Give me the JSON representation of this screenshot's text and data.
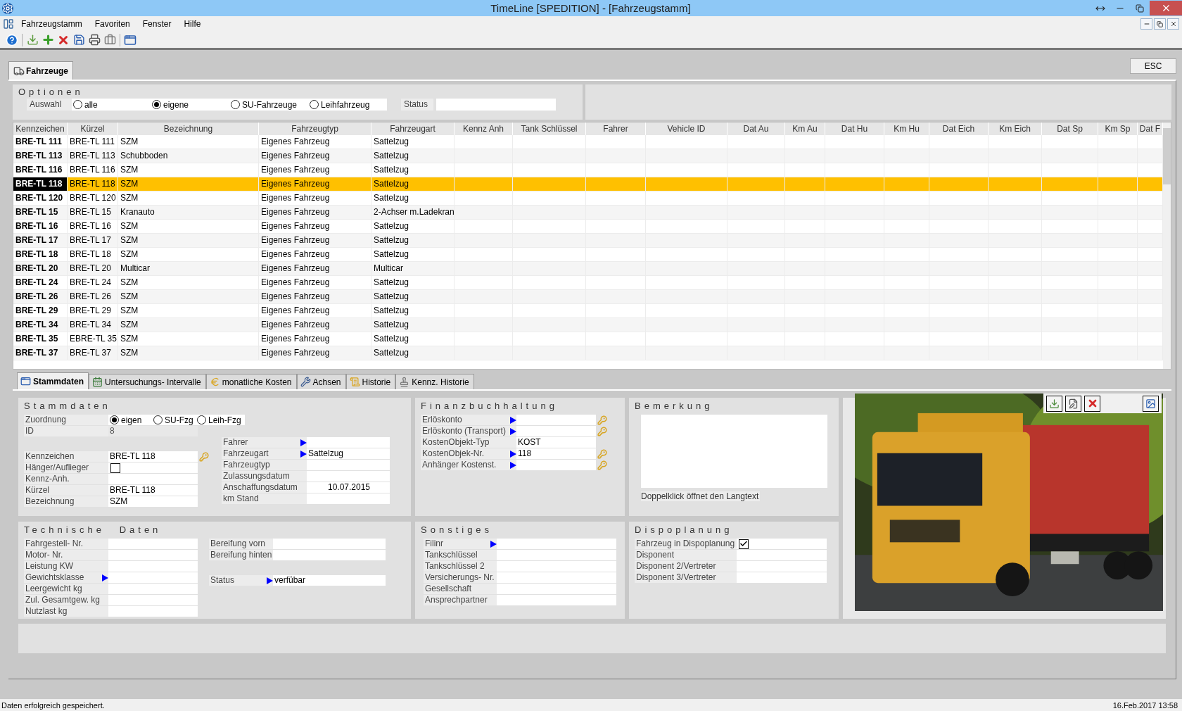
{
  "window": {
    "title": "TimeLine [SPEDITION] - [Fahrzeugstamm]"
  },
  "menu": [
    "Fahrzeugstamm",
    "Favoriten",
    "Fenster",
    "Hilfe"
  ],
  "main_tab": {
    "label": "Fahrzeuge",
    "selected": true
  },
  "esc_button": "ESC",
  "options": {
    "title": "Optionen",
    "selection_label": "Auswahl",
    "radios": [
      {
        "label": "alle",
        "selected": false
      },
      {
        "label": "eigene",
        "selected": true
      },
      {
        "label": "SU-Fahrzeuge",
        "selected": false
      },
      {
        "label": "Leihfahrzeug",
        "selected": false
      }
    ],
    "status_label": "Status"
  },
  "table": {
    "columns": [
      "Kennzeichen",
      "Kürzel",
      "Bezeichnung",
      "Fahrzeugtyp",
      "Fahrzeugart",
      "Kennz Anh",
      "Tank Schlüssel",
      "Fahrer",
      "Vehicle ID",
      "Dat Au",
      "Km Au",
      "Dat Hu",
      "Km Hu",
      "Dat Eich",
      "Km Eich",
      "Dat Sp",
      "Km Sp",
      "Dat F"
    ],
    "rows": [
      {
        "cells": [
          "BRE-TL 111",
          "BRE-TL 111",
          "SZM",
          "Eigenes Fahrzeug",
          "Sattelzug"
        ],
        "selected": false
      },
      {
        "cells": [
          "BRE-TL 113",
          "BRE-TL 113",
          "Schubboden",
          "Eigenes Fahrzeug",
          "Sattelzug"
        ],
        "selected": false
      },
      {
        "cells": [
          "BRE-TL 116",
          "BRE-TL 116",
          "SZM",
          "Eigenes Fahrzeug",
          "Sattelzug"
        ],
        "selected": false
      },
      {
        "cells": [
          "BRE-TL 118",
          "BRE-TL 118",
          "SZM",
          "Eigenes Fahrzeug",
          "Sattelzug"
        ],
        "selected": true
      },
      {
        "cells": [
          "BRE-TL 120",
          "BRE-TL 120",
          "SZM",
          "Eigenes Fahrzeug",
          "Sattelzug"
        ],
        "selected": false
      },
      {
        "cells": [
          "BRE-TL 15",
          "BRE-TL 15",
          "Kranauto",
          "Eigenes Fahrzeug",
          "2-Achser m.Ladekran"
        ],
        "selected": false
      },
      {
        "cells": [
          "BRE-TL 16",
          "BRE-TL 16",
          "SZM",
          "Eigenes Fahrzeug",
          "Sattelzug"
        ],
        "selected": false
      },
      {
        "cells": [
          "BRE-TL 17",
          "BRE-TL 17",
          "SZM",
          "Eigenes Fahrzeug",
          "Sattelzug"
        ],
        "selected": false
      },
      {
        "cells": [
          "BRE-TL 18",
          "BRE-TL 18",
          "SZM",
          "Eigenes Fahrzeug",
          "Sattelzug"
        ],
        "selected": false
      },
      {
        "cells": [
          "BRE-TL 20",
          "BRE-TL 20",
          "Multicar",
          "Eigenes Fahrzeug",
          "Multicar"
        ],
        "selected": false
      },
      {
        "cells": [
          "BRE-TL 24",
          "BRE-TL 24",
          "SZM",
          "Eigenes Fahrzeug",
          "Sattelzug"
        ],
        "selected": false
      },
      {
        "cells": [
          "BRE-TL 26",
          "BRE-TL 26",
          "SZM",
          "Eigenes Fahrzeug",
          "Sattelzug"
        ],
        "selected": false
      },
      {
        "cells": [
          "BRE-TL 29",
          "BRE-TL 29",
          "SZM",
          "Eigenes Fahrzeug",
          "Sattelzug"
        ],
        "selected": false
      },
      {
        "cells": [
          "BRE-TL 34",
          "BRE-TL 34",
          "SZM",
          "Eigenes Fahrzeug",
          "Sattelzug"
        ],
        "selected": false
      },
      {
        "cells": [
          "BRE-TL 35",
          "EBRE-TL 35",
          "SZM",
          "Eigenes Fahrzeug",
          "Sattelzug"
        ],
        "selected": false
      },
      {
        "cells": [
          "BRE-TL 37",
          "BRE-TL 37",
          "SZM",
          "Eigenes Fahrzeug",
          "Sattelzug"
        ],
        "selected": false
      }
    ]
  },
  "detail_tabs": [
    {
      "label": "Stammdaten",
      "selected": true
    },
    {
      "label": "Untersuchungs- Intervalle",
      "selected": false
    },
    {
      "label": "monatliche Kosten",
      "selected": false
    },
    {
      "label": "Achsen",
      "selected": false
    },
    {
      "label": "Historie",
      "selected": false
    },
    {
      "label": "Kennz. Historie",
      "selected": false
    }
  ],
  "stammdaten": {
    "title": "Stammdaten",
    "assignment": {
      "label": "Zuordnung",
      "radios": [
        {
          "label": "eigen",
          "selected": true
        },
        {
          "label": "SU-Fzg",
          "selected": false
        },
        {
          "label": "Leih-Fzg",
          "selected": false
        }
      ]
    },
    "left_fields": [
      {
        "label": "ID",
        "kind": "readonly",
        "value": "8"
      },
      {
        "label": "Kennzeichen",
        "kind": "text",
        "value": "BRE-TL 118",
        "key": true
      },
      {
        "label": "Hänger/Auflieger",
        "kind": "checkbox",
        "checked": false
      },
      {
        "label": "Kennz-Anh.",
        "kind": "text"
      },
      {
        "label": "Kürzel",
        "kind": "text",
        "value": "BRE-TL 118"
      },
      {
        "label": "Bezeichnung",
        "kind": "text",
        "value": "SZM"
      }
    ],
    "right_fields": [
      {
        "label": "Fahrer",
        "kind": "lookup"
      },
      {
        "label": "Fahrzeugart",
        "kind": "lookup",
        "value": "Sattelzug"
      },
      {
        "label": "Fahrzeugtyp",
        "kind": "text"
      },
      {
        "label": "Zulassungsdatum",
        "kind": "text"
      },
      {
        "label": "Anschaffungsdatum",
        "kind": "date",
        "value": "10.07.2015"
      },
      {
        "label": "km Stand",
        "kind": "text"
      }
    ]
  },
  "technische_daten": {
    "title": "Technische Daten",
    "left_fields": [
      {
        "label": "Fahrgestell- Nr.",
        "kind": "text"
      },
      {
        "label": "Motor- Nr.",
        "kind": "text"
      },
      {
        "label": "Leistung KW",
        "kind": "text"
      },
      {
        "label": "Gewichtsklasse",
        "kind": "lookup"
      },
      {
        "label": "Leergewicht kg",
        "kind": "text"
      },
      {
        "label": "Zul. Gesamtgew. kg",
        "kind": "text"
      },
      {
        "label": "Nutzlast kg",
        "kind": "text"
      }
    ],
    "right_fields": [
      {
        "label": "Bereifung vorn",
        "kind": "text"
      },
      {
        "label": "Bereifung hinten",
        "kind": "text"
      },
      {
        "label": "Status",
        "kind": "lookup",
        "value": "verfübar"
      }
    ]
  },
  "finanzbuchhaltung": {
    "title": "Finanzbuchhaltung",
    "fields": [
      {
        "label": "Erlöskonto",
        "kind": "lookup",
        "key": true
      },
      {
        "label": "Erlöskonto (Transport)",
        "kind": "lookup",
        "key": true
      },
      {
        "label": "KostenObjekt-Typ",
        "kind": "text",
        "value": "KOST"
      },
      {
        "label": "KostenObjek-Nr.",
        "kind": "lookup",
        "value": "118",
        "key": true
      },
      {
        "label": "Anhänger Kostenst.",
        "kind": "lookup",
        "key": true
      }
    ]
  },
  "bemerkung": {
    "title": "Bemerkung",
    "hint": "Doppelklick öffnet den Langtext"
  },
  "sonstiges": {
    "title": "Sonstiges",
    "fields": [
      {
        "label": "Filinr",
        "kind": "lookup"
      },
      {
        "label": "Tankschlüssel",
        "kind": "text"
      },
      {
        "label": "Tankschlüssel 2",
        "kind": "text"
      },
      {
        "label": "Versicherungs- Nr.",
        "kind": "text"
      },
      {
        "label": "Gesellschaft",
        "kind": "text"
      },
      {
        "label": "Ansprechpartner",
        "kind": "text"
      }
    ]
  },
  "dispoplanung": {
    "title": "Dispoplanung",
    "fields": [
      {
        "label": "Fahrzeug in Dispoplanung",
        "kind": "checkbox",
        "checked": true
      },
      {
        "label": "Disponent",
        "kind": "text"
      },
      {
        "label": "Disponent 2/Vertreter",
        "kind": "text"
      },
      {
        "label": "Disponent 3/Vertreter",
        "kind": "text"
      }
    ]
  },
  "photo": {
    "kind": "picture"
  },
  "status_bar": {
    "message": "Daten erfolgreich gespeichert.",
    "datetime": "16.Feb.2017 13:58"
  }
}
